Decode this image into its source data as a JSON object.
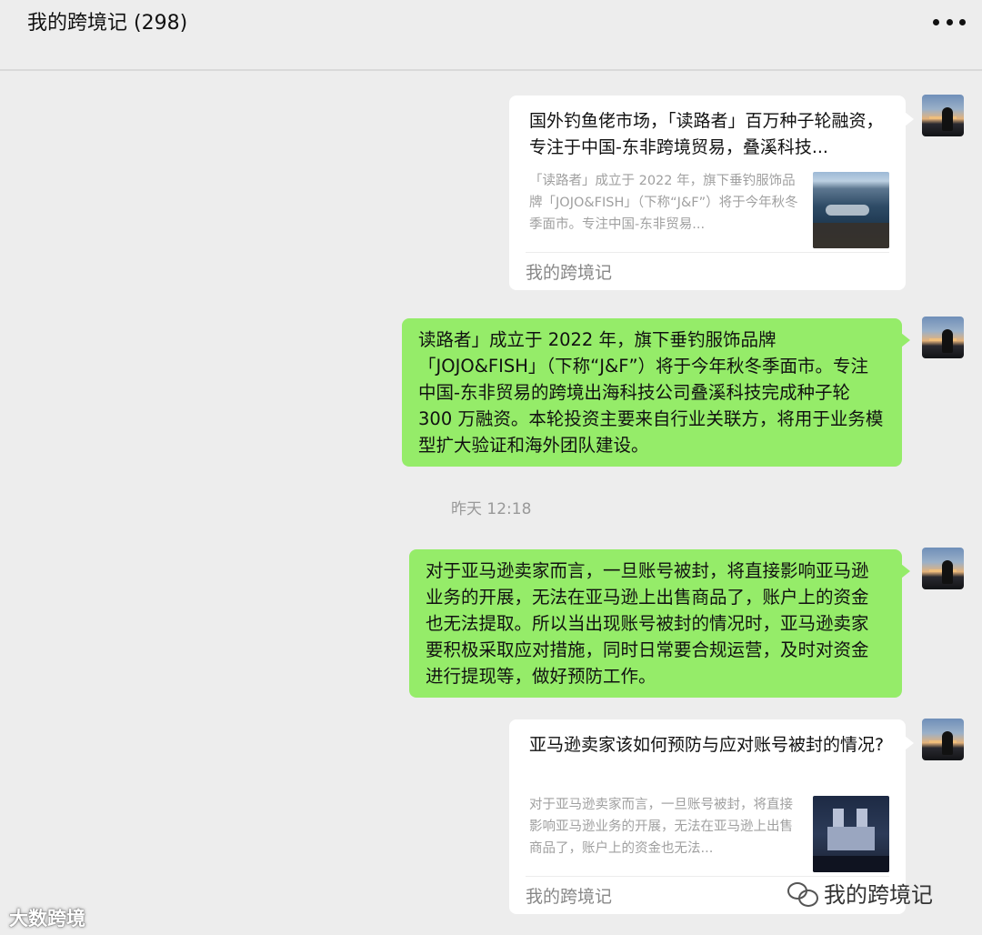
{
  "header": {
    "title": "我的跨境记 (298)",
    "more_icon": "more-icon"
  },
  "messages": {
    "card1": {
      "title": "国外钓鱼佬市场，「读路者」百万种子轮融资，专注于中国-东非跨境贸易，叠溪科技...",
      "desc": "「读路者」成立于 2022 年，旗下垂钓服饰品牌「JOJO&FISH」（下称“J&F”）将于今年秋冬季面市。专注中国-东非贸易...",
      "source": "我的跨境记",
      "thumb_icon": "river-photo"
    },
    "bubble1": "读路者」成立于 2022 年，旗下垂钓服饰品牌「JOJO&FISH」（下称“J&F”）将于今年秋冬季面市。专注中国-东非贸易的跨境出海科技公司叠溪科技完成种子轮 300 万融资。本轮投资主要来自行业关联方，将用于业务模型扩大验证和海外团队建设。",
    "time": "昨天 12:18",
    "bubble2": "对于亚马逊卖家而言，一旦账号被封，将直接影响亚马逊业务的开展，无法在亚马逊上出售商品了，账户上的资金也无法提取。所以当出现账号被封的情况时，亚马逊卖家要积极采取应对措施，同时日常要合规运营，及时对资金进行提现等，做好预防工作。",
    "card2": {
      "title": "亚马逊卖家该如何预防与应对账号被封的情况?",
      "desc": "对于亚马逊卖家而言，一旦账号被封，将直接影响亚马逊业务的开展，无法在亚马逊上出售商品了，账户上的资金也无法...",
      "source": "我的跨境记",
      "thumb_icon": "cathedral-photo"
    }
  },
  "watermarks": {
    "left": "大数跨境",
    "right": "我的跨境记"
  },
  "colors": {
    "background": "#ededed",
    "bubble_green": "#95ec69",
    "card_white": "#ffffff"
  }
}
